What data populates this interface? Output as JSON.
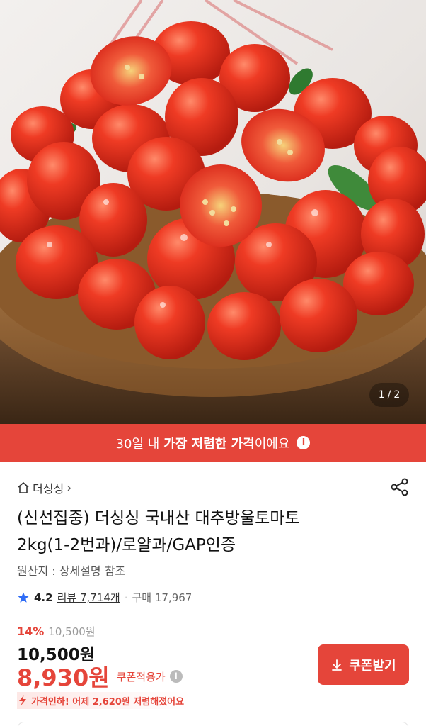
{
  "gallery": {
    "image_alt": "cherry tomatoes in a wooden bowl",
    "current": "1",
    "separator": "/",
    "total": "2"
  },
  "banner": {
    "prefix": "30일 내",
    "emphasis": "가장 저렴한 가격",
    "suffix": "이에요",
    "info_icon": "i"
  },
  "product": {
    "store_name": "더싱싱",
    "store_chevron": "›",
    "title_line1": "(신선집중) 더싱싱 국내산 대추방울토마토",
    "title_line2": "2kg(1-2번과)/로얄과/GAP인증",
    "origin": "원산지 : 상세설명 참조",
    "rating": "4.2",
    "reviews": "리뷰 7,714개",
    "separator": "·",
    "purchases": "구매 17,967"
  },
  "pricing": {
    "discount": "14%",
    "original": "10,500원",
    "price": "10,500원",
    "coupon_price": "8,930원",
    "coupon_applied": "쿠폰적용가",
    "info_icon": "i",
    "drop_note": "가격인하! 어제 2,620원 저렴해졌어요"
  },
  "coupon_button": {
    "label": "쿠폰받기"
  },
  "colors": {
    "accent": "#e5453a",
    "star": "#2f6df6"
  }
}
